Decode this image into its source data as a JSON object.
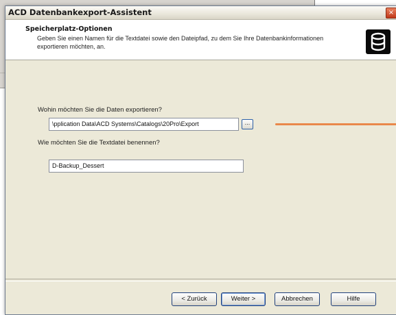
{
  "dialog": {
    "title": "ACD Datenbankexport-Assistent",
    "close_glyph": "×"
  },
  "header": {
    "title": "Speicherplatz-Optionen",
    "description": "Geben Sie einen Namen für die Textdatei sowie den Dateipfad, zu dem Sie Ihre Datenbankinformationen exportieren möchten, an.",
    "icon": "database-icon"
  },
  "form": {
    "export_path_label": "Wohin möchten Sie die Daten exportieren?",
    "export_path_value": "\\pplication Data\\ACD Systems\\Catalogs\\20Pro\\Export",
    "browse_label": "...",
    "filename_label": "Wie möchten Sie die Textdatei benennen?",
    "filename_value": "D-Backup_Dessert"
  },
  "buttons": {
    "back": "< Zurück",
    "next": "Weiter >",
    "cancel": "Abbrechen",
    "help": "Hilfe"
  },
  "colors": {
    "callout": "#e9884a",
    "dialog_bg": "#ece9d8"
  }
}
